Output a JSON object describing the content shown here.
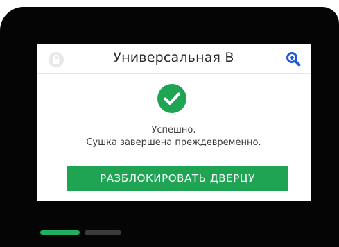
{
  "header": {
    "title": "Универсальная В",
    "lock_icon": "lock-icon",
    "zoom_icon": "zoom-in-icon"
  },
  "status": {
    "icon": "checkmark-icon",
    "line1": "Успешно.",
    "line2": "Сушка завершена преждевременно."
  },
  "actions": {
    "unlock_door_label": "РАЗБЛОКИРОВАТЬ ДВЕРЦУ"
  },
  "pager": {
    "pages": 2,
    "active_page": 1
  },
  "colors": {
    "accent": "#1fa453",
    "device_bezel": "#050505",
    "lock_icon_bg": "#e8e8e8",
    "zoom_icon": "#1e5bd8",
    "pager_active": "#22b060",
    "pager_inactive": "#3b3b3b"
  }
}
